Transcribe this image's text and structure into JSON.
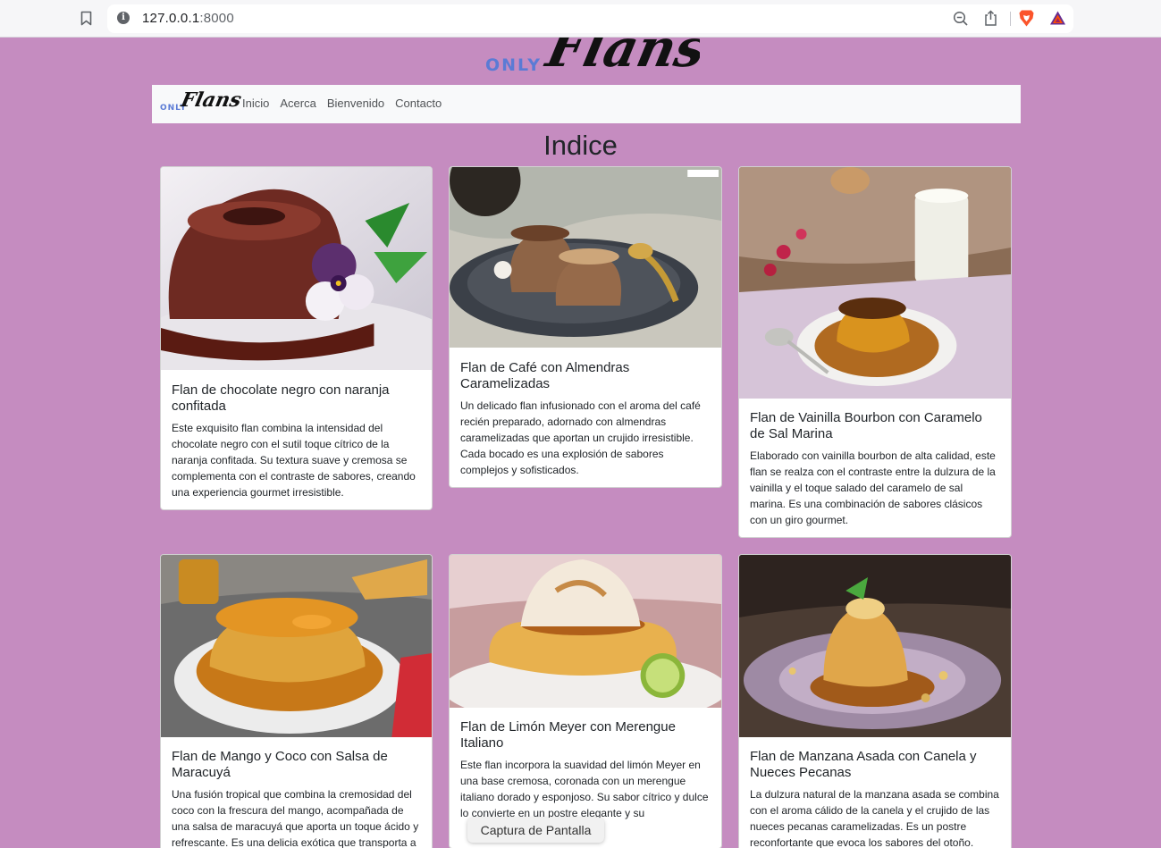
{
  "browser": {
    "url_host": "127.0.0.1",
    "url_port": ":8000"
  },
  "brand": {
    "prefix": "ONLY",
    "name": "Flans",
    "accent_color": "#5b7bd5",
    "background_color": "#c58cc0"
  },
  "nav": {
    "items": [
      {
        "label": "Inicio"
      },
      {
        "label": "Acerca"
      },
      {
        "label": "Bienvenido"
      },
      {
        "label": "Contacto"
      }
    ]
  },
  "page": {
    "title": "Indice"
  },
  "cards": [
    {
      "title": "Flan de chocolate negro con naranja confitada",
      "text": "Este exquisito flan combina la intensidad del chocolate negro con el sutil toque cítrico de la naranja confitada. Su textura suave y cremosa se complementa con el contraste de sabores, creando una experiencia gourmet irresistible."
    },
    {
      "title": "Flan de Café con Almendras Caramelizadas",
      "text": "Un delicado flan infusionado con el aroma del café recién preparado, adornado con almendras caramelizadas que aportan un crujido irresistible. Cada bocado es una explosión de sabores complejos y sofisticados."
    },
    {
      "title": "Flan de Vainilla Bourbon con Caramelo de Sal Marina",
      "text": "Elaborado con vainilla bourbon de alta calidad, este flan se realza con el contraste entre la dulzura de la vainilla y el toque salado del caramelo de sal marina. Es una combinación de sabores clásicos con un giro gourmet."
    },
    {
      "title": "Flan de Mango y Coco con Salsa de Maracuyá",
      "text": "Una fusión tropical que combina la cremosidad del coco con la frescura del mango, acompañada de una salsa de maracuyá que aporta un toque ácido y refrescante. Es una delicia exótica que transporta a"
    },
    {
      "title": "Flan de Limón Meyer con Merengue Italiano",
      "text": "Este flan incorpora la suavidad del limón Meyer en una base cremosa, coronada con un merengue italiano dorado y esponjoso. Su sabor cítrico y dulce lo convierte en un postre elegante y su"
    },
    {
      "title": "Flan de Manzana Asada con Canela y Nueces Pecanas",
      "text": "La dulzura natural de la manzana asada se combina con el aroma cálido de la canela y el crujido de las nueces pecanas caramelizadas. Es un postre reconfortante que evoca los sabores del otoño."
    }
  ],
  "toast": {
    "label": "Captura de Pantalla"
  },
  "icons": [
    "bookmark-icon",
    "info-icon",
    "zoom-out-icon",
    "share-icon",
    "brave-lion-icon",
    "bat-triangle-icon"
  ]
}
